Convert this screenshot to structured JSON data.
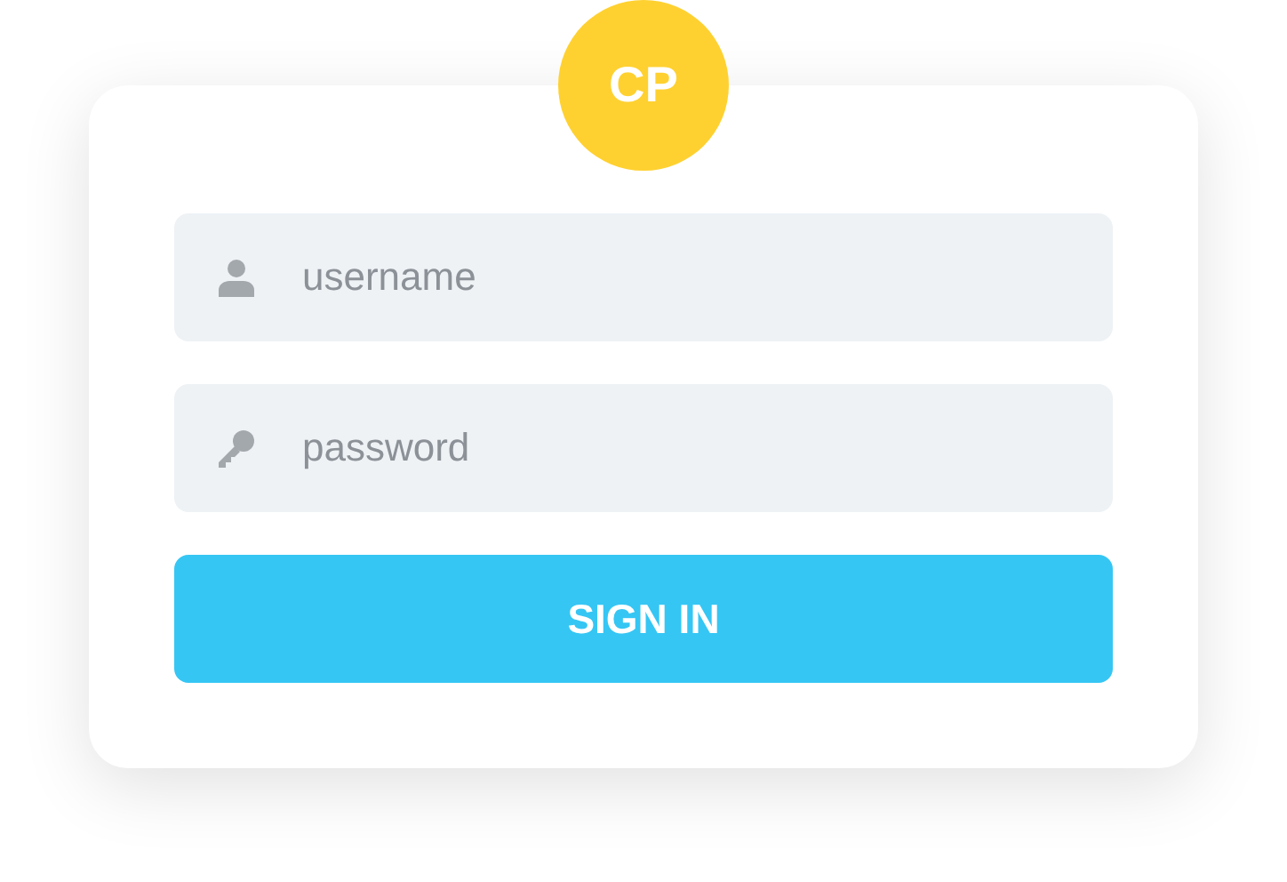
{
  "logo": {
    "text": "CP"
  },
  "fields": [
    {
      "kind": "user",
      "placeholder": "username"
    },
    {
      "kind": "key",
      "placeholder": "password"
    }
  ],
  "button": {
    "label": "SIGN IN"
  }
}
